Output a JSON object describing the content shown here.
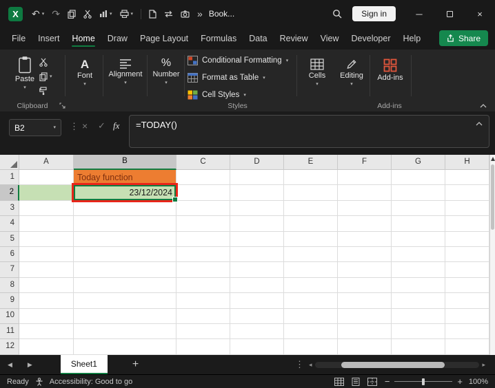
{
  "colors": {
    "accent_green": "#107C41",
    "share_green": "#15884E",
    "highlight_red": "#E8251A",
    "orange_fill": "#ED7D31",
    "green_fill": "#C6E0B4"
  },
  "icons": {
    "undo": "↶",
    "redo": "↷",
    "caret_down": "▾",
    "overflow": "»",
    "minimize": "─",
    "close": "×",
    "dots_vertical": "⋮",
    "cancel": "×",
    "confirm": "✓",
    "prev_arrow": "◀",
    "next_arrow": "▶",
    "scroll_left": "◂",
    "scroll_right": "▸",
    "zoom_out": "−",
    "zoom_in": "+",
    "font": "A",
    "number_format": "%",
    "excel_logo": "X"
  },
  "titlebar": {
    "doc_title": "Book...",
    "sign_in_label": "Sign in"
  },
  "menubar": {
    "items": [
      "File",
      "Insert",
      "Home",
      "Draw",
      "Page Layout",
      "Formulas",
      "Data",
      "Review",
      "View",
      "Developer",
      "Help"
    ],
    "active_item": "Home",
    "share_label": "Share"
  },
  "ribbon": {
    "paste_label": "Paste",
    "font_label": "Font",
    "alignment_label": "Alignment",
    "number_label": "Number",
    "styles_buttons": [
      "Conditional Formatting",
      "Format as Table",
      "Cell Styles"
    ],
    "cells_label": "Cells",
    "editing_label": "Editing",
    "addins_label": "Add-ins",
    "group_labels": {
      "clipboard": "Clipboard",
      "styles": "Styles",
      "addins": "Add-ins"
    }
  },
  "formula_bar": {
    "name_box_value": "B2",
    "fx_label": "fx",
    "formula_value": "=TODAY()"
  },
  "grid": {
    "column_headers": [
      "A",
      "B",
      "C",
      "D",
      "E",
      "F",
      "G",
      "H"
    ],
    "row_headers": [
      "1",
      "2",
      "3",
      "4",
      "5",
      "6",
      "7",
      "8",
      "9",
      "10",
      "11",
      "12"
    ],
    "selected_cell": "B2",
    "selected_column": "B",
    "selected_row": "2",
    "cells": [
      {
        "ref": "B1",
        "text": "Today function",
        "fill": "#ED7D31",
        "color": "#7E2F0E",
        "align": "left"
      },
      {
        "ref": "A2",
        "text": "",
        "fill": "#C6E0B4",
        "align": "left"
      },
      {
        "ref": "B2",
        "text": "23/12/2024",
        "fill": "#C6E0B4",
        "color": "#1A1A1A",
        "align": "right"
      }
    ]
  },
  "sheet_bar": {
    "tabs": [
      {
        "label": "Sheet1",
        "active": true
      }
    ],
    "add_sheet_label": "+"
  },
  "status_bar": {
    "mode": "Ready",
    "accessibility_text": "Accessibility: Good to go",
    "zoom_level": "100%"
  }
}
